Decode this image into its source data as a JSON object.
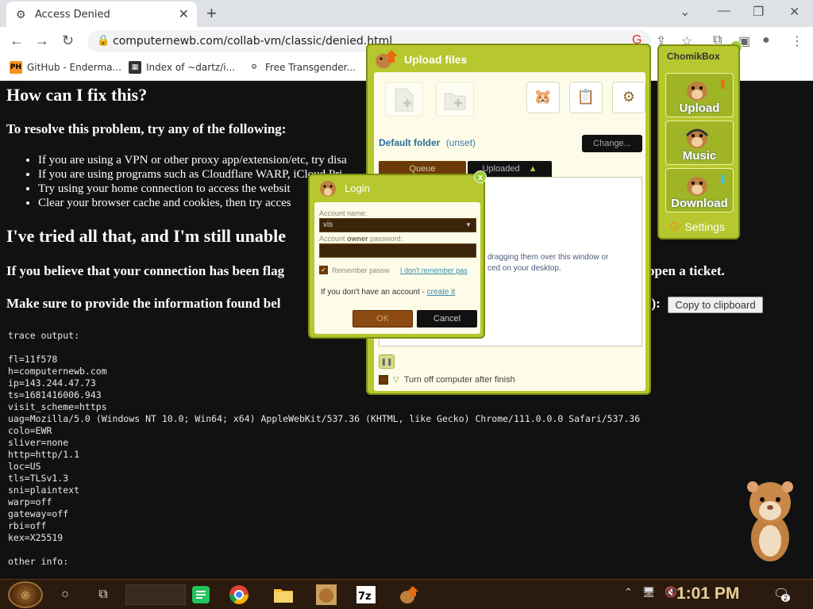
{
  "browser": {
    "tab_title": "Access Denied",
    "url": "computernewb.com/collab-vm/classic/denied.html",
    "bookmarks": [
      {
        "label": "GitHub - Enderma...",
        "icon": "PH"
      },
      {
        "label": "Index of ~dartz/i...",
        "icon": "grid"
      },
      {
        "label": "Free Transgender...",
        "icon": "globe"
      }
    ]
  },
  "page": {
    "h_fix": "How can I fix this?",
    "h_resolve": "To resolve this problem, try any of the following:",
    "bullets": [
      "If you are using a VPN or other proxy app/extension/etc, try disa",
      "If you are using programs such as Cloudflare WARP, iCloud Pri",
      "Try using your home connection to access the websit",
      "Clear your browser cache and cookies, then try acces"
    ],
    "h_tried": "I've tried all that, and I'm still unable",
    "h_flag_a": "If you believe that your connection has been flag",
    "h_flag_b": "open a ticket.",
    "h_provide": "Make sure to provide the information found bel",
    "h_provide_end": "y):",
    "copy_button": "Copy to clipboard",
    "trace": "trace output:\n\nfl=11f578\nh=computernewb.com\nip=143.244.47.73\nts=1681416006.943\nvisit_scheme=https\nuag=Mozilla/5.0 (Windows NT 10.0; Win64; x64) AppleWebKit/537.36 (KHTML, like Gecko) Chrome/111.0.0.0 Safari/537.36\ncolo=EWR\nsliver=none\nhttp=http/1.1\nloc=US\ntls=TLSv1.3\nsni=plaintext\nwarp=off\ngateway=off\nrbi=off\nkex=X25519\n\nother info:"
  },
  "upload": {
    "title": "Upload files",
    "default_folder_label": "Default folder",
    "default_folder_value": "(unset)",
    "change_button": "Change...",
    "tab_queue": "Queue",
    "tab_uploaded": "Uploaded",
    "drop_text_1": "dragging them over this window or",
    "drop_text_2": "ced on your desktop.",
    "turn_off": "Turn off computer after finish"
  },
  "login": {
    "title": "Login",
    "account_label": "Account name:",
    "account_value": "vis",
    "password_label_a": "Account",
    "password_label_b": "owner",
    "password_label_c": "password:",
    "remember": "Remember passw",
    "forgot": "I don't remember pas",
    "no_account": "If you don't have an account -",
    "create_it": "create it",
    "ok": "OK",
    "cancel": "Cancel"
  },
  "chomikbox": {
    "title": "ChomikBox",
    "upload": "Upload",
    "music": "Music",
    "download": "Download",
    "settings": "Settings"
  },
  "taskbar": {
    "clock": "1:01 PM",
    "notifications": "2"
  },
  "colors": {
    "accent_olive": "#b7c72f",
    "dark_brown": "#6b3a07",
    "page_bg": "#111111"
  }
}
